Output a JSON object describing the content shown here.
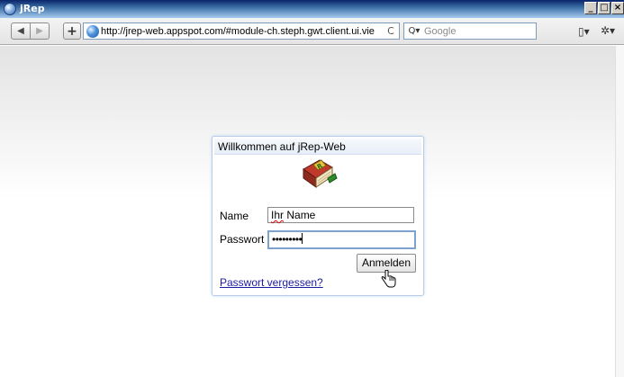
{
  "window": {
    "title": "jRep",
    "minimize_glyph": "_",
    "maximize_glyph": "□",
    "close_glyph": "×"
  },
  "toolbar": {
    "back_glyph": "◀",
    "forward_glyph": "▶",
    "add_glyph": "+",
    "url": "http://jrep-web.appspot.com/#module-ch.steph.gwt.client.ui.vie",
    "reload_glyph": "C",
    "search_icon_glyph": "Q▾",
    "search_placeholder": "Google",
    "page_menu_glyph": "▯▾",
    "tools_menu_glyph": "✲▾"
  },
  "login": {
    "title": "Willkommen auf jRep-Web",
    "name_label": "Name",
    "name_value_prefix": "Ihr",
    "name_value_rest": " Name",
    "password_label": "Passwort",
    "password_masked": "•••••••••",
    "login_button": "Anmelden",
    "forgot_link": "Passwort vergessen?"
  },
  "colors": {
    "title_bar": "#0a246a",
    "dialog_border": "#b9cde7",
    "link": "#1c1ca0",
    "focus_border": "#7da2ce"
  },
  "icons": {
    "app": "globe-icon",
    "logo": "book-logo-icon",
    "cursor": "hand-pointer-icon"
  }
}
